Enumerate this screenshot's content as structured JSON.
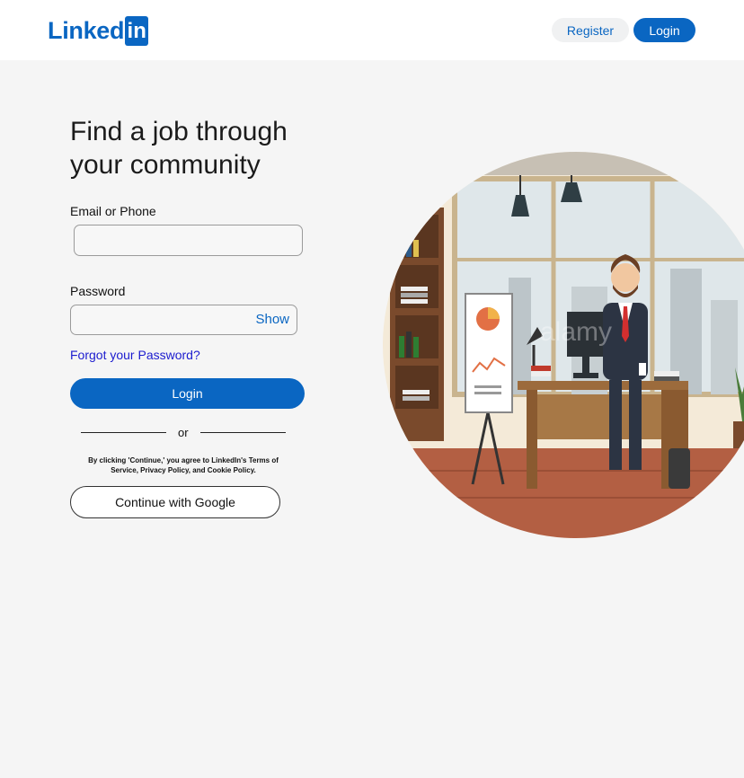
{
  "header": {
    "logo_text": "Linked",
    "logo_box_text": "in",
    "register_label": "Register",
    "login_label": "Login"
  },
  "main": {
    "headline": "Find a job through your community",
    "email_label": "Email or Phone",
    "email_value": "",
    "password_label": "Password",
    "password_value": "",
    "show_label": "Show",
    "forgot_link": "Forgot your Password?",
    "login_button": "Login",
    "divider_text": "or",
    "terms_text": "By clicking 'Continue,' you agree to LinkedIn's Terms of Service, Privacy Policy, and Cookie Policy.",
    "google_button": "Continue with Google"
  },
  "illustration": {
    "watermark": "alamy"
  },
  "colors": {
    "brand": "#0a66c2",
    "page_bg": "#f5f5f5",
    "link": "#1c1ccf"
  }
}
